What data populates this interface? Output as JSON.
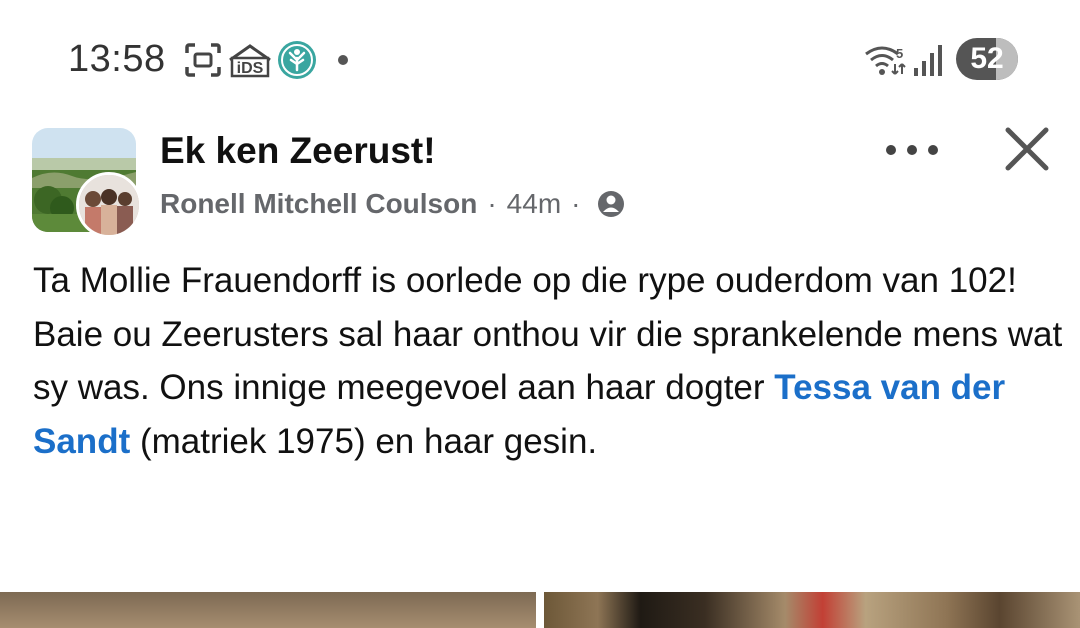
{
  "status_bar": {
    "time": "13:58",
    "icons": [
      "screenshot-icon",
      "ids-app-icon",
      "tree-app-icon",
      "notification-dot"
    ],
    "right_icons": [
      "wifi-5-icon",
      "signal-icon"
    ],
    "battery": "52",
    "ids_label": "iDS"
  },
  "post": {
    "group_name": "Ek ken Zeerust!",
    "author": "Ronell Mitchell Coulson",
    "sep1": "·",
    "time": "44m",
    "sep2": "·",
    "privacy_icon": "group-members-icon",
    "text_line1": "Ta Mollie Frauendorff is oorlede op die rype ouderdom van 102!",
    "text_line2_before": "Baie ou Zeerusters sal haar onthou vir die sprankelende mens wat sy was. Ons innige meegevoel aan haar dogter ",
    "mention": "Tessa van der Sandt",
    "text_line2_after": " (matriek 1975) en haar gesin."
  },
  "colors": {
    "mention": "#1b6fc9",
    "meta": "#65676b",
    "text": "#111111"
  }
}
